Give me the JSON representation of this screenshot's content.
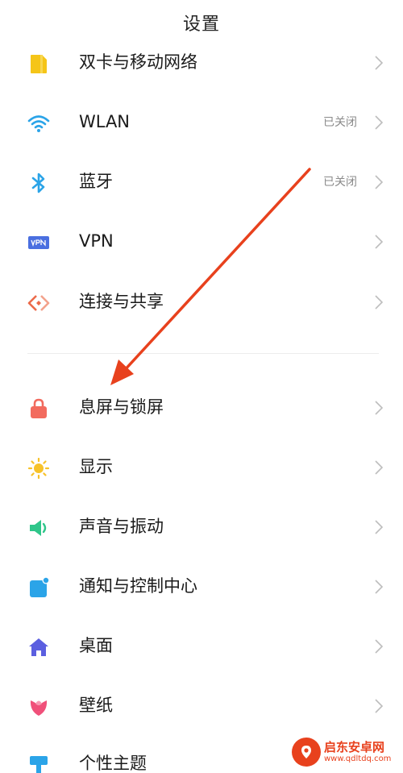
{
  "header": {
    "title": "设置"
  },
  "settings": [
    {
      "label": "双卡与移动网络",
      "status": "",
      "icon": "sim-card-icon",
      "color": "#f5c518"
    },
    {
      "label": "WLAN",
      "status": "已关闭",
      "icon": "wifi-icon",
      "color": "#2ba4e8"
    },
    {
      "label": "蓝牙",
      "status": "已关闭",
      "icon": "bluetooth-icon",
      "color": "#2ba4e8"
    },
    {
      "label": "VPN",
      "status": "",
      "icon": "vpn-icon",
      "color": "#4a6fe0"
    },
    {
      "label": "连接与共享",
      "status": "",
      "icon": "connection-share-icon",
      "color": "#ec6a4a"
    },
    {
      "label": "息屏与锁屏",
      "status": "",
      "icon": "lock-icon",
      "color": "#f26b5e"
    },
    {
      "label": "显示",
      "status": "",
      "icon": "sun-icon",
      "color": "#f7c22a"
    },
    {
      "label": "声音与振动",
      "status": "",
      "icon": "speaker-icon",
      "color": "#2fc68a"
    },
    {
      "label": "通知与控制中心",
      "status": "",
      "icon": "notification-icon",
      "color": "#2ba4e8"
    },
    {
      "label": "桌面",
      "status": "",
      "icon": "home-icon",
      "color": "#5b5fe0"
    },
    {
      "label": "壁纸",
      "status": "",
      "icon": "tulip-icon",
      "color": "#f0507a"
    },
    {
      "label": "个性主题",
      "status": "",
      "icon": "brush-icon",
      "color": "#2ba4e8"
    }
  ],
  "annotation": {
    "arrow_color": "#e8411d",
    "arrow_icon": "red-arrow-icon"
  },
  "watermark": {
    "name": "启东安卓网",
    "url": "www.qdltdq.com",
    "brand_color": "#e8411d"
  }
}
